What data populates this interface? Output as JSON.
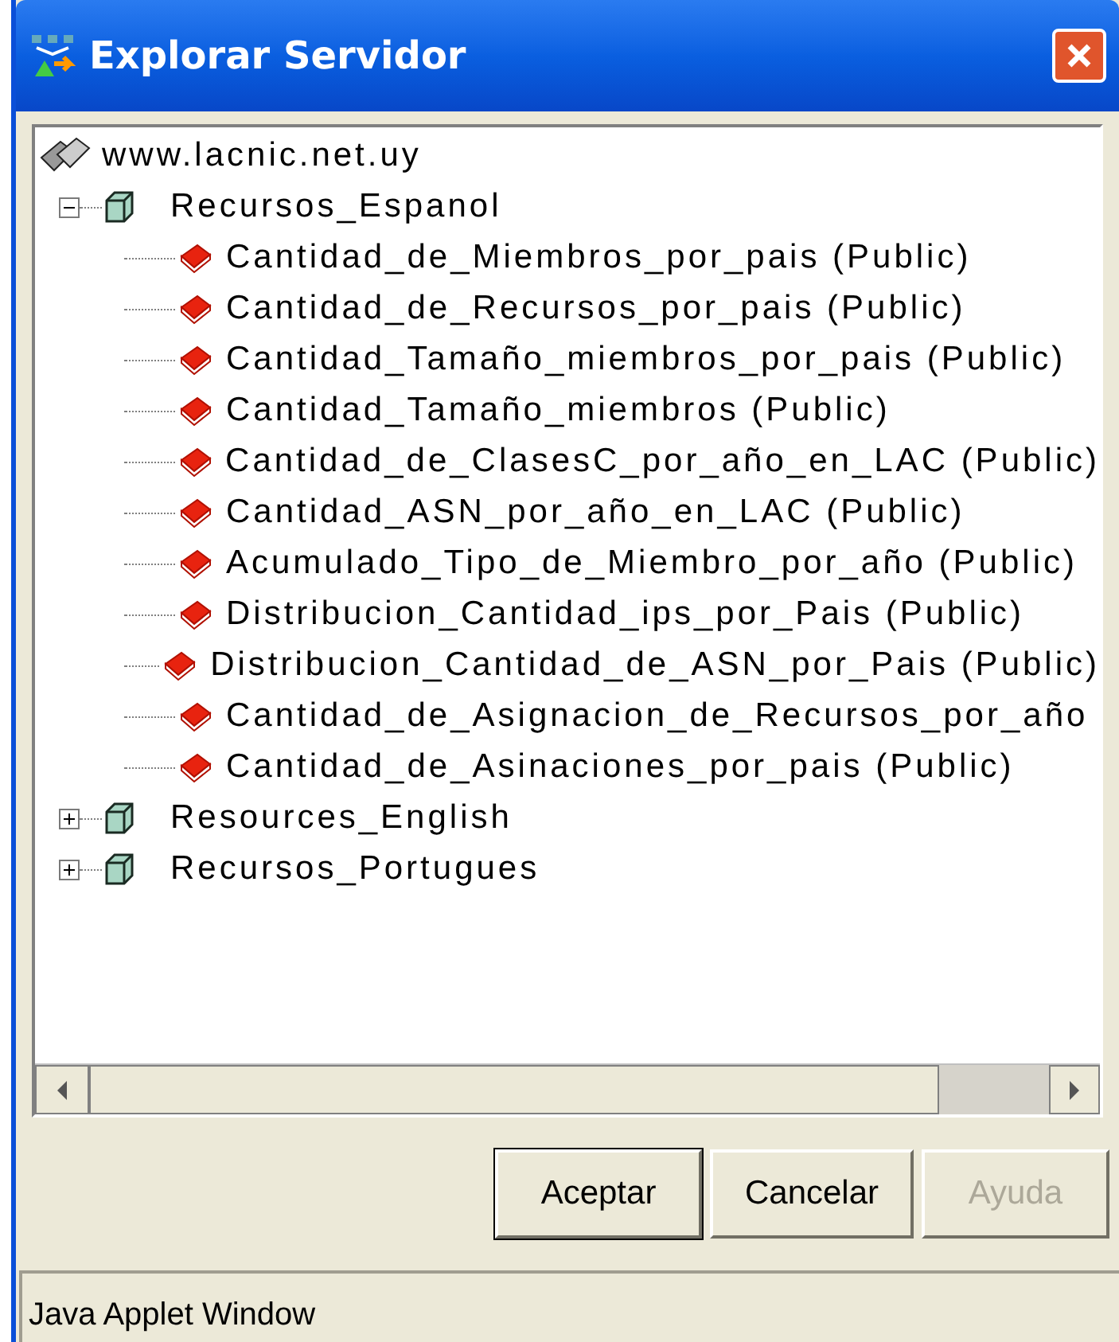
{
  "window": {
    "title": "Explorar Servidor"
  },
  "tree": {
    "label": "www.lacnic.net.uy",
    "children": [
      {
        "label": "Recursos_Espanol",
        "expanded": true,
        "children": [
          {
            "label": "Cantidad_de_Miembros_por_pais (Public)"
          },
          {
            "label": "Cantidad_de_Recursos_por_pais (Public)"
          },
          {
            "label": "Cantidad_Tamaño_miembros_por_pais (Public)"
          },
          {
            "label": "Cantidad_Tamaño_miembros (Public)"
          },
          {
            "label": "Cantidad_de_ClasesC_por_año_en_LAC (Public)"
          },
          {
            "label": "Cantidad_ASN_por_año_en_LAC (Public)"
          },
          {
            "label": "Acumulado_Tipo_de_Miembro_por_año (Public)"
          },
          {
            "label": "Distribucion_Cantidad_ips_por_Pais (Public)"
          },
          {
            "label": "Distribucion_Cantidad_de_ASN_por_Pais (Public)"
          },
          {
            "label": "Cantidad_de_Asignacion_de_Recursos_por_año"
          },
          {
            "label": "Cantidad_de_Asinaciones_por_pais (Public)"
          }
        ]
      },
      {
        "label": "Resources_English",
        "expanded": false
      },
      {
        "label": "Recursos_Portugues",
        "expanded": false
      }
    ]
  },
  "buttons": [
    {
      "label": "Aceptar",
      "disabled": false
    },
    {
      "label": "Cancelar",
      "disabled": false
    },
    {
      "label": "Ayuda",
      "disabled": true
    }
  ],
  "status_bar": "Java Applet Window"
}
